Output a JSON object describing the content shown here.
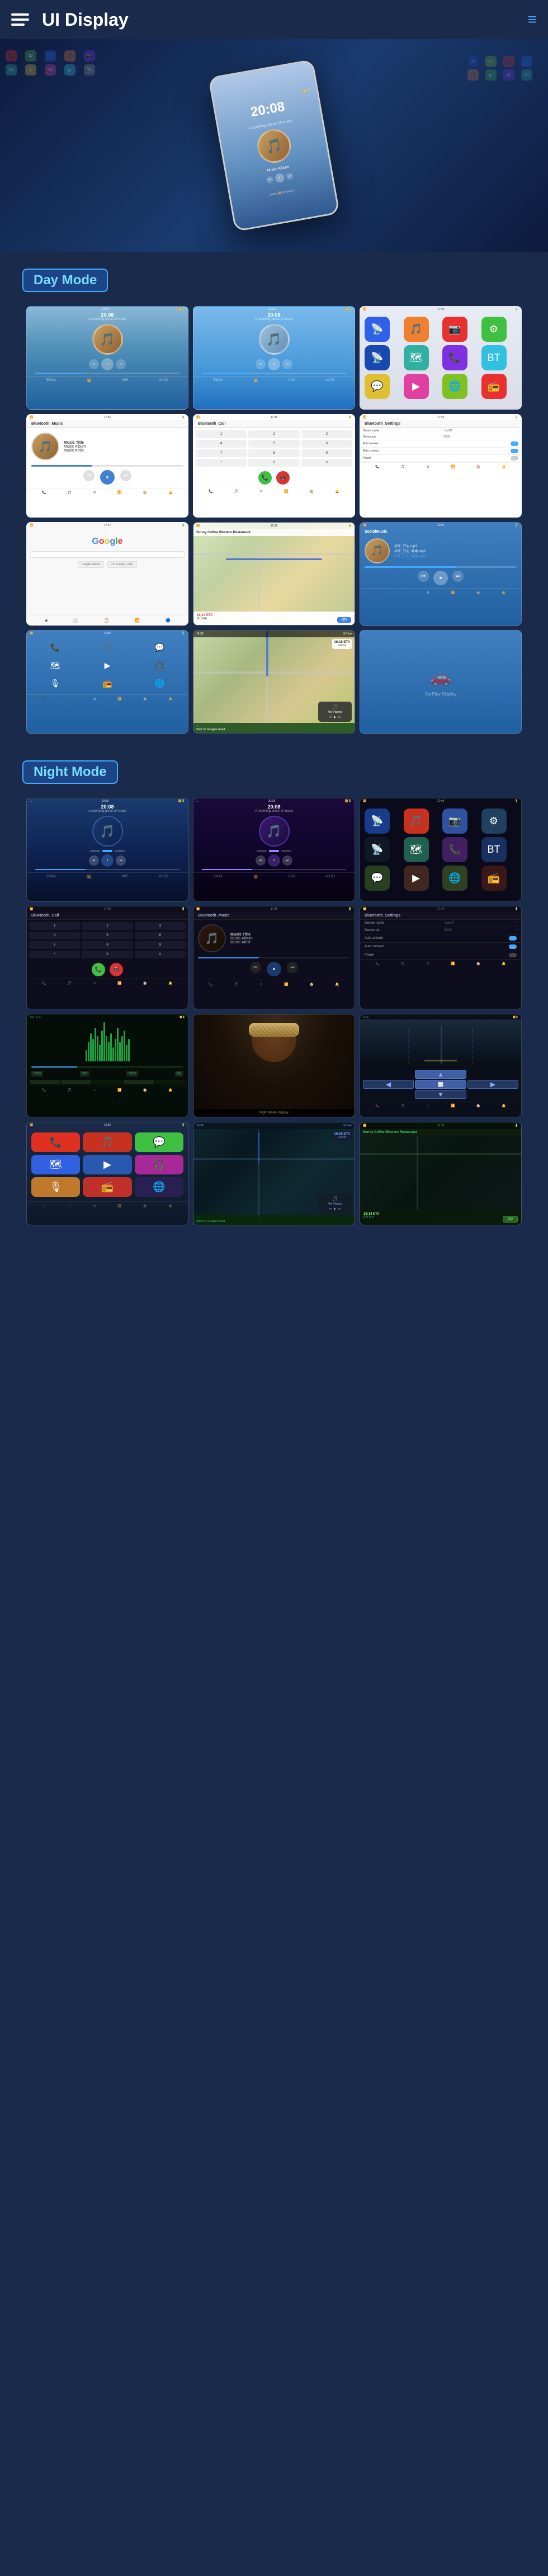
{
  "header": {
    "title": "UI Display",
    "menu_icon": "≡",
    "hamburger_lines": 3
  },
  "sections": {
    "day_mode": {
      "label": "Day Mode"
    },
    "night_mode": {
      "label": "Night Mode"
    }
  },
  "music": {
    "title": "Music Title",
    "album": "Music Album",
    "artist": "Music Artist",
    "time": "20:08",
    "subtitle": "A soothing piece of music"
  },
  "screens": {
    "time": "20:08",
    "bluetooth_music": "Bluetooth_Music",
    "bluetooth_call": "Bluetooth_Call",
    "bluetooth_settings": "Bluetooth_Settings",
    "device_name": "CarBT",
    "device_pin": "0000",
    "auto_answer": "Auto answer",
    "auto_connect": "Auto connect",
    "power": "Power",
    "google": "Google",
    "social_music": "SocialMusic",
    "sunny_coffee": "Sunny Coffee Western Restaurant",
    "eta": "16:14 ETA",
    "distance": "9.0 km",
    "start_on": "Start on Gongjue Road",
    "not_playing": "Not Playing",
    "go": "GO"
  },
  "app_icons": {
    "phone": "📞",
    "music": "🎵",
    "maps": "🗺",
    "settings": "⚙",
    "messages": "💬",
    "mail": "✉",
    "camera": "📷",
    "photos": "🖼",
    "safari": "🌐",
    "youtube": "▶",
    "spotify": "🎧",
    "podcast": "🎙",
    "carplay": "🚗",
    "netflix": "N",
    "waze": "W",
    "bt": "BT"
  }
}
